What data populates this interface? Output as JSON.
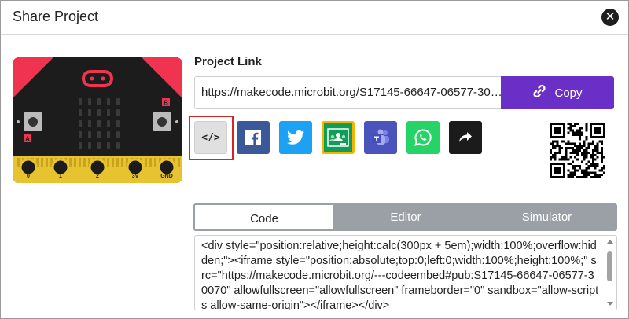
{
  "dialog": {
    "title": "Share Project",
    "close_icon": "close-icon"
  },
  "thumbnail": {
    "pin_labels": [
      "0",
      "1",
      "2",
      "3V",
      "GND"
    ],
    "button_labels": [
      "A",
      "B"
    ]
  },
  "project_link": {
    "label": "Project Link",
    "url": "https://makecode.microbit.org/S17145-66647-06577-30…",
    "copy_label": "Copy",
    "copy_icon": "link-icon"
  },
  "share_buttons": [
    {
      "name": "embed",
      "icon": "code-icon",
      "color": "#e0e0e0"
    },
    {
      "name": "facebook",
      "icon": "facebook-icon",
      "color": "#3b5998"
    },
    {
      "name": "twitter",
      "icon": "twitter-icon",
      "color": "#1da1f2"
    },
    {
      "name": "google-classroom",
      "icon": "google-classroom-icon",
      "color": "#0f9d58"
    },
    {
      "name": "microsoft-teams",
      "icon": "teams-icon",
      "color": "#4b53bc"
    },
    {
      "name": "whatsapp",
      "icon": "whatsapp-icon",
      "color": "#25d366"
    },
    {
      "name": "share",
      "icon": "share-arrow-icon",
      "color": "#1b1b1b"
    }
  ],
  "tabs": {
    "code": "Code",
    "editor": "Editor",
    "simulator": "Simulator",
    "active": "Code"
  },
  "embed_code": "<div style=\"position:relative;height:calc(300px + 5em);width:100%;overflow:hidden;\"><iframe style=\"position:absolute;top:0;left:0;width:100%;height:100%;\" src=\"https://makecode.microbit.org/---codeembed#pub:S17145-66647-06577-30070\" allowfullscreen=\"allowfullscreen\" frameborder=\"0\" sandbox=\"allow-scripts allow-same-origin\"></iframe></div>",
  "colors": {
    "accent_purple": "#6a2fc7",
    "highlight_red": "#d62323",
    "tab_gray": "#9aa0a6"
  }
}
